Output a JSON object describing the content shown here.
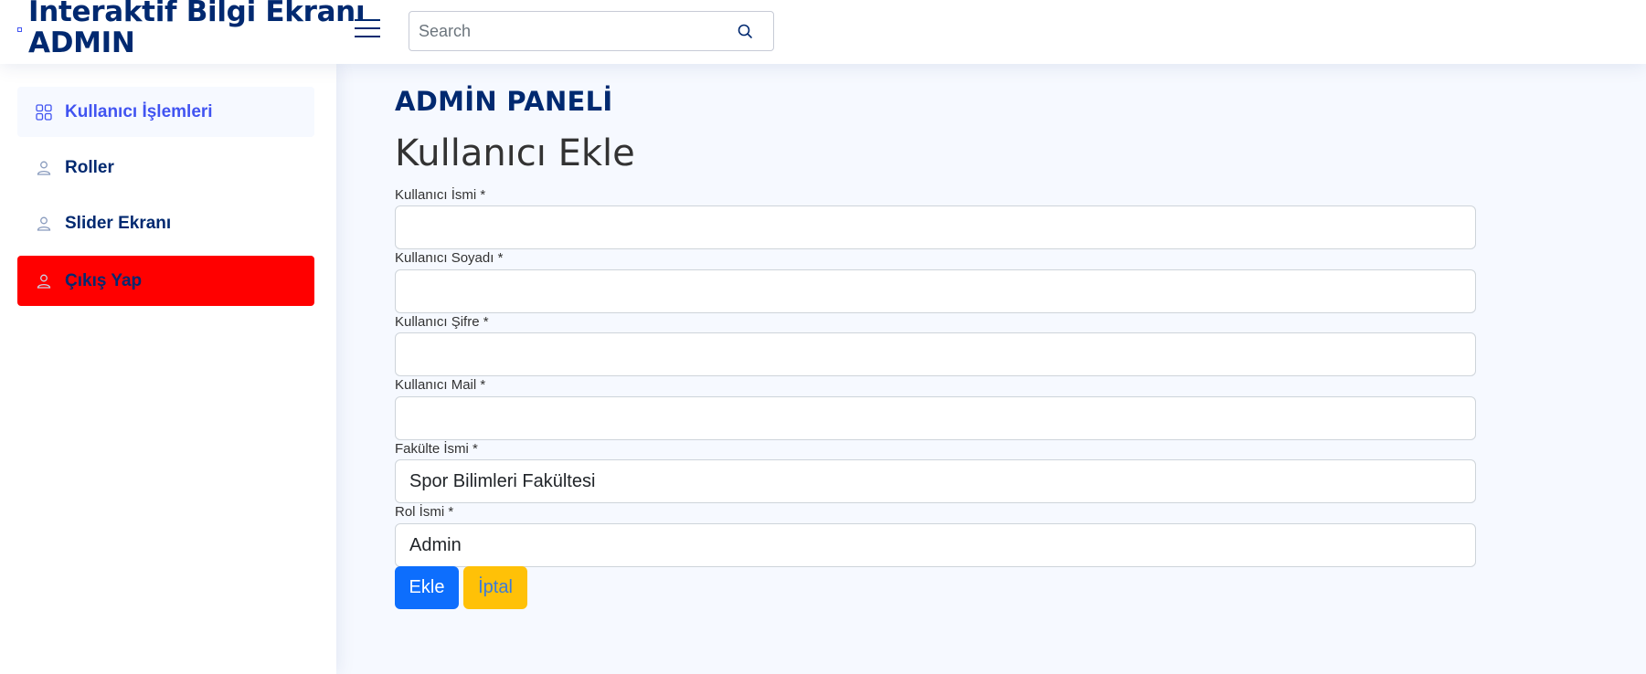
{
  "header": {
    "title_line1": "İnteraktif Bilgi Ekranı",
    "title_line2": "ADMIN",
    "search": {
      "placeholder": "Search",
      "value": ""
    },
    "icons": [
      "logo-icon",
      "menu-icon",
      "search-icon"
    ]
  },
  "sidebar": {
    "items": [
      {
        "label": "Kullanıcı İşlemleri",
        "icon": "grid-icon",
        "state": "active"
      },
      {
        "label": "Roller",
        "icon": "person-icon"
      },
      {
        "label": "Slider Ekranı",
        "icon": "person-icon"
      },
      {
        "label": "Çıkış Yap",
        "icon": "person-icon",
        "state": "danger"
      }
    ]
  },
  "main": {
    "page_title": "ADMİN PANELİ",
    "form_title": "Kullanıcı Ekle",
    "fields": [
      {
        "label": "Kullanıcı İsmi *",
        "value": ""
      },
      {
        "label": "Kullanıcı Soyadı *",
        "value": ""
      },
      {
        "label": "Kullanıcı Şifre *",
        "value": ""
      },
      {
        "label": "Kullanıcı Mail *",
        "value": ""
      },
      {
        "label": "Fakülte İsmi *",
        "value": "Spor Bilimleri Fakültesi"
      },
      {
        "label": "Rol İsmi *",
        "value": "Admin"
      }
    ],
    "buttons": {
      "submit": "Ekle",
      "cancel": "İptal"
    }
  },
  "colors": {
    "brand": "#012970",
    "accent": "#4154f1",
    "background": "#f6f9ff",
    "danger": "#ff0000",
    "primary_button": "#0d6efd",
    "warning_button": "#ffc107"
  }
}
